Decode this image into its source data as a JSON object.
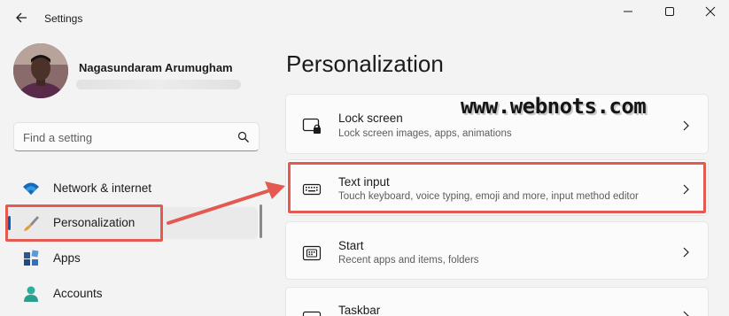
{
  "window": {
    "title": "Settings",
    "controls": [
      "minimize-icon",
      "maximize-icon",
      "close-icon"
    ]
  },
  "profile": {
    "name": "Nagasundaram Arumugham"
  },
  "search": {
    "placeholder": "Find a setting"
  },
  "sidebar": {
    "items": [
      {
        "label": "Network & internet",
        "icon": "wifi-icon",
        "selected": false
      },
      {
        "label": "Personalization",
        "icon": "brush-icon",
        "selected": true
      },
      {
        "label": "Apps",
        "icon": "apps-icon",
        "selected": false
      },
      {
        "label": "Accounts",
        "icon": "person-icon",
        "selected": false
      }
    ]
  },
  "main": {
    "title": "Personalization",
    "cards": [
      {
        "title": "Lock screen",
        "subtitle": "Lock screen images, apps, animations",
        "icon": "lock-screen-icon"
      },
      {
        "title": "Text input",
        "subtitle": "Touch keyboard, voice typing, emoji and more, input method editor",
        "icon": "keyboard-icon"
      },
      {
        "title": "Start",
        "subtitle": "Recent apps and items, folders",
        "icon": "start-icon"
      },
      {
        "title": "Taskbar",
        "subtitle": "",
        "icon": "taskbar-icon"
      }
    ]
  },
  "watermark": {
    "text": "www.webnots.com"
  },
  "colors": {
    "accent": "#005fb8",
    "highlight_box": "#e25a50",
    "background": "#f3f3f3",
    "card": "#fbfbfb"
  }
}
